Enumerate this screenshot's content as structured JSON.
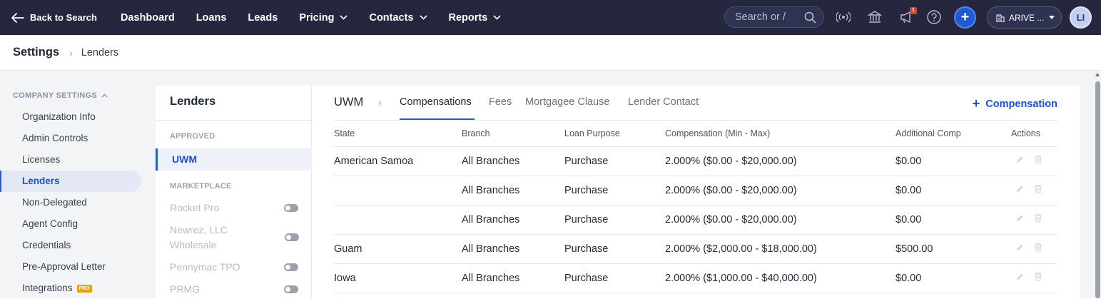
{
  "topbar": {
    "back_label": "Back to Search",
    "nav": [
      {
        "label": "Dashboard",
        "has_menu": false
      },
      {
        "label": "Loans",
        "has_menu": false
      },
      {
        "label": "Leads",
        "has_menu": false
      },
      {
        "label": "Pricing",
        "has_menu": true
      },
      {
        "label": "Contacts",
        "has_menu": true
      },
      {
        "label": "Reports",
        "has_menu": true
      }
    ],
    "search_placeholder": "Search or /",
    "notification_count": "1",
    "org_label": "ARIVE ...",
    "avatar_initials": "LI",
    "icons": [
      "broadcast-icon",
      "bank-icon",
      "announcement-icon",
      "help-icon",
      "plus-icon"
    ],
    "colors": {
      "bar_bg": "#25273f",
      "primary": "#1e5ad6"
    }
  },
  "breadcrumb": {
    "title": "Settings",
    "current": "Lenders"
  },
  "sidebar": {
    "section_label": "COMPANY SETTINGS",
    "items": [
      {
        "label": "Organization Info",
        "active": false
      },
      {
        "label": "Admin Controls",
        "active": false
      },
      {
        "label": "Licenses",
        "active": false
      },
      {
        "label": "Lenders",
        "active": true
      },
      {
        "label": "Non-Delegated",
        "active": false
      },
      {
        "label": "Agent Config",
        "active": false
      },
      {
        "label": "Credentials",
        "active": false
      },
      {
        "label": "Pre-Approval Letter",
        "active": false
      },
      {
        "label": "Integrations",
        "active": false,
        "badge": "PRO"
      }
    ]
  },
  "lenders_panel": {
    "title": "Lenders",
    "approved_label": "APPROVED",
    "approved": [
      {
        "label": "UWM",
        "selected": true
      }
    ],
    "marketplace_label": "MARKETPLACE",
    "marketplace": [
      {
        "label": "Rocket Pro",
        "enabled": false
      },
      {
        "label": "Newrez, LLC Wholesale",
        "enabled": false
      },
      {
        "label": "Pennymac TPO",
        "enabled": false
      },
      {
        "label": "PRMG",
        "enabled": false
      }
    ]
  },
  "detail": {
    "lender": "UWM",
    "tabs": [
      {
        "label": "Compensations",
        "active": true
      },
      {
        "label": "Fees",
        "active": false
      },
      {
        "label": "Mortgagee Clause",
        "active": false
      },
      {
        "label": "Lender Contact",
        "active": false
      }
    ],
    "add_button": "Compensation",
    "columns": [
      "State",
      "Branch",
      "Loan Purpose",
      "Compensation (Min - Max)",
      "Additional Comp",
      "Actions"
    ],
    "rows": [
      {
        "state": "American Samoa",
        "branch": "All Branches",
        "purpose": "Purchase",
        "comp": "2.000% ($0.00 - $20,000.00)",
        "additional": "$0.00"
      },
      {
        "state": "",
        "branch": "All Branches",
        "purpose": "Purchase",
        "comp": "2.000% ($0.00 - $20,000.00)",
        "additional": "$0.00"
      },
      {
        "state": "",
        "branch": "All Branches",
        "purpose": "Purchase",
        "comp": "2.000% ($0.00 - $20,000.00)",
        "additional": "$0.00"
      },
      {
        "state": "Guam",
        "branch": "All Branches",
        "purpose": "Purchase",
        "comp": "2.000% ($2,000.00 - $18,000.00)",
        "additional": "$500.00"
      },
      {
        "state": "Iowa",
        "branch": "All Branches",
        "purpose": "Purchase",
        "comp": "2.000% ($1,000.00 - $40,000.00)",
        "additional": "$0.00"
      }
    ]
  }
}
